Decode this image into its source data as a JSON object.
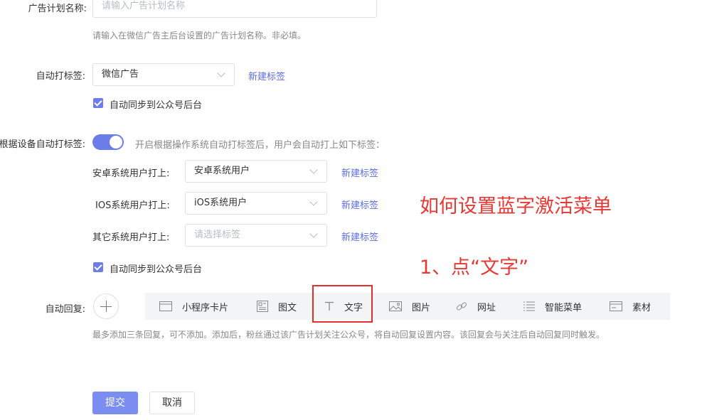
{
  "form": {
    "plan_name": {
      "label": "广告计划名称:",
      "placeholder": "请输入广告计划名称",
      "hint": "请输入在微信广告主后台设置的广告计划名称。非必填。"
    },
    "auto_tag": {
      "label": "自动打标签:",
      "value": "微信广告",
      "new_tag_link": "新建标签",
      "sync_checkbox_label": "自动同步到公众号后台",
      "sync_checked": true
    },
    "device_tag": {
      "label": "根据设备自动打标签:",
      "switch_on": true,
      "description": "开启根据操作系统自动打标签后，用户会自动打上如下标签：",
      "rows": [
        {
          "label": "安卓系统用户打上:",
          "value": "安卓系统用户",
          "is_placeholder": false,
          "new_tag_link": "新建标签"
        },
        {
          "label": "IOS系统用户打上:",
          "value": "iOS系统用户",
          "is_placeholder": false,
          "new_tag_link": "新建标签"
        },
        {
          "label": "其它系统用户打上:",
          "value": "请选择标签",
          "is_placeholder": true,
          "new_tag_link": "新建标签"
        }
      ],
      "sync_checkbox_label": "自动同步到公众号后台",
      "sync_checked": true
    },
    "auto_reply": {
      "label": "自动回复:",
      "toolbar": [
        {
          "label": "小程序卡片",
          "icon": "mini-program-card-icon"
        },
        {
          "label": "图文",
          "icon": "article-icon"
        },
        {
          "label": "文字",
          "icon": "text-icon"
        },
        {
          "label": "图片",
          "icon": "image-icon"
        },
        {
          "label": "网址",
          "icon": "link-icon"
        },
        {
          "label": "智能菜单",
          "icon": "menu-list-icon"
        },
        {
          "label": "素材",
          "icon": "material-icon"
        }
      ],
      "hint": "最多添加三条回复，可不添加。添加后，粉丝通过该广告计划关注公众号，将自动回复设置内容。该回复会与关注后自动回复同时触发。"
    }
  },
  "annotations": {
    "title": "如何设置蓝字激活菜单",
    "step": "1、点“文字”",
    "color": "#e53935"
  },
  "buttons": {
    "submit": "提交",
    "cancel": "取消"
  },
  "colors": {
    "accent": "#6c7ce8",
    "link": "#5b6ee1",
    "primary_button": "#7b8df0",
    "highlight": "#e0302d"
  }
}
